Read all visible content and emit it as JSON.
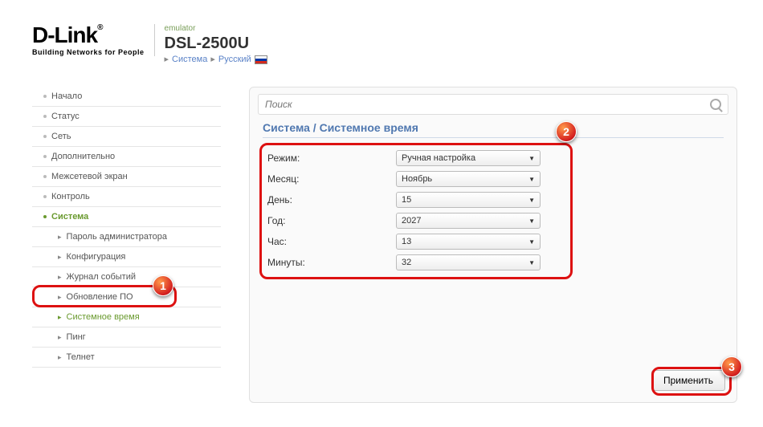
{
  "header": {
    "brand": "D-Link",
    "brand_sub": "Building Networks for People",
    "emulator": "emulator",
    "model": "DSL-2500U",
    "crumb1": "Система",
    "crumb2": "Русский"
  },
  "search": {
    "placeholder": "Поиск"
  },
  "nav": {
    "items": [
      "Начало",
      "Статус",
      "Сеть",
      "Дополнительно",
      "Межсетевой экран",
      "Контроль",
      "Система"
    ],
    "sub": [
      "Пароль администратора",
      "Конфигурация",
      "Журнал событий",
      "Обновление ПО",
      "Системное время",
      "Пинг",
      "Телнет"
    ]
  },
  "breadcrumb": "Система /  Системное время",
  "form": {
    "mode_label": "Режим:",
    "mode_value": "Ручная настройка",
    "month_label": "Месяц:",
    "month_value": "Ноябрь",
    "day_label": "День:",
    "day_value": "15",
    "year_label": "Год:",
    "year_value": "2027",
    "hour_label": "Час:",
    "hour_value": "13",
    "min_label": "Минуты:",
    "min_value": "32"
  },
  "apply": "Применить",
  "badges": {
    "b1": "1",
    "b2": "2",
    "b3": "3"
  }
}
